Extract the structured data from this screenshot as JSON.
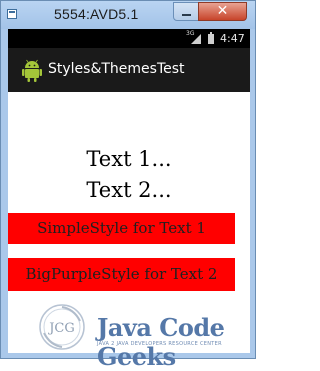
{
  "window": {
    "title": "5554:AVD5.1",
    "minimize_glyph": "",
    "close_glyph": "✕"
  },
  "statusbar": {
    "network": "3G",
    "time": "4:47"
  },
  "actionbar": {
    "title": "Styles&ThemesTest"
  },
  "content": {
    "text1": "Text 1...",
    "text2": "Text 2...",
    "simple_style": "SimpleStyle for Text 1",
    "big_purple_style": "BigPurpleStyle for Text 2"
  },
  "watermark": {
    "logo_initials": "JCG",
    "name": "Java Code Geeks",
    "tagline": "JAVA 2 JAVA DEVELOPERS RESOURCE CENTER"
  },
  "colors": {
    "accent_red": "#ff0000",
    "logo_blue": "#5578a8",
    "android_green": "#a4c639"
  }
}
